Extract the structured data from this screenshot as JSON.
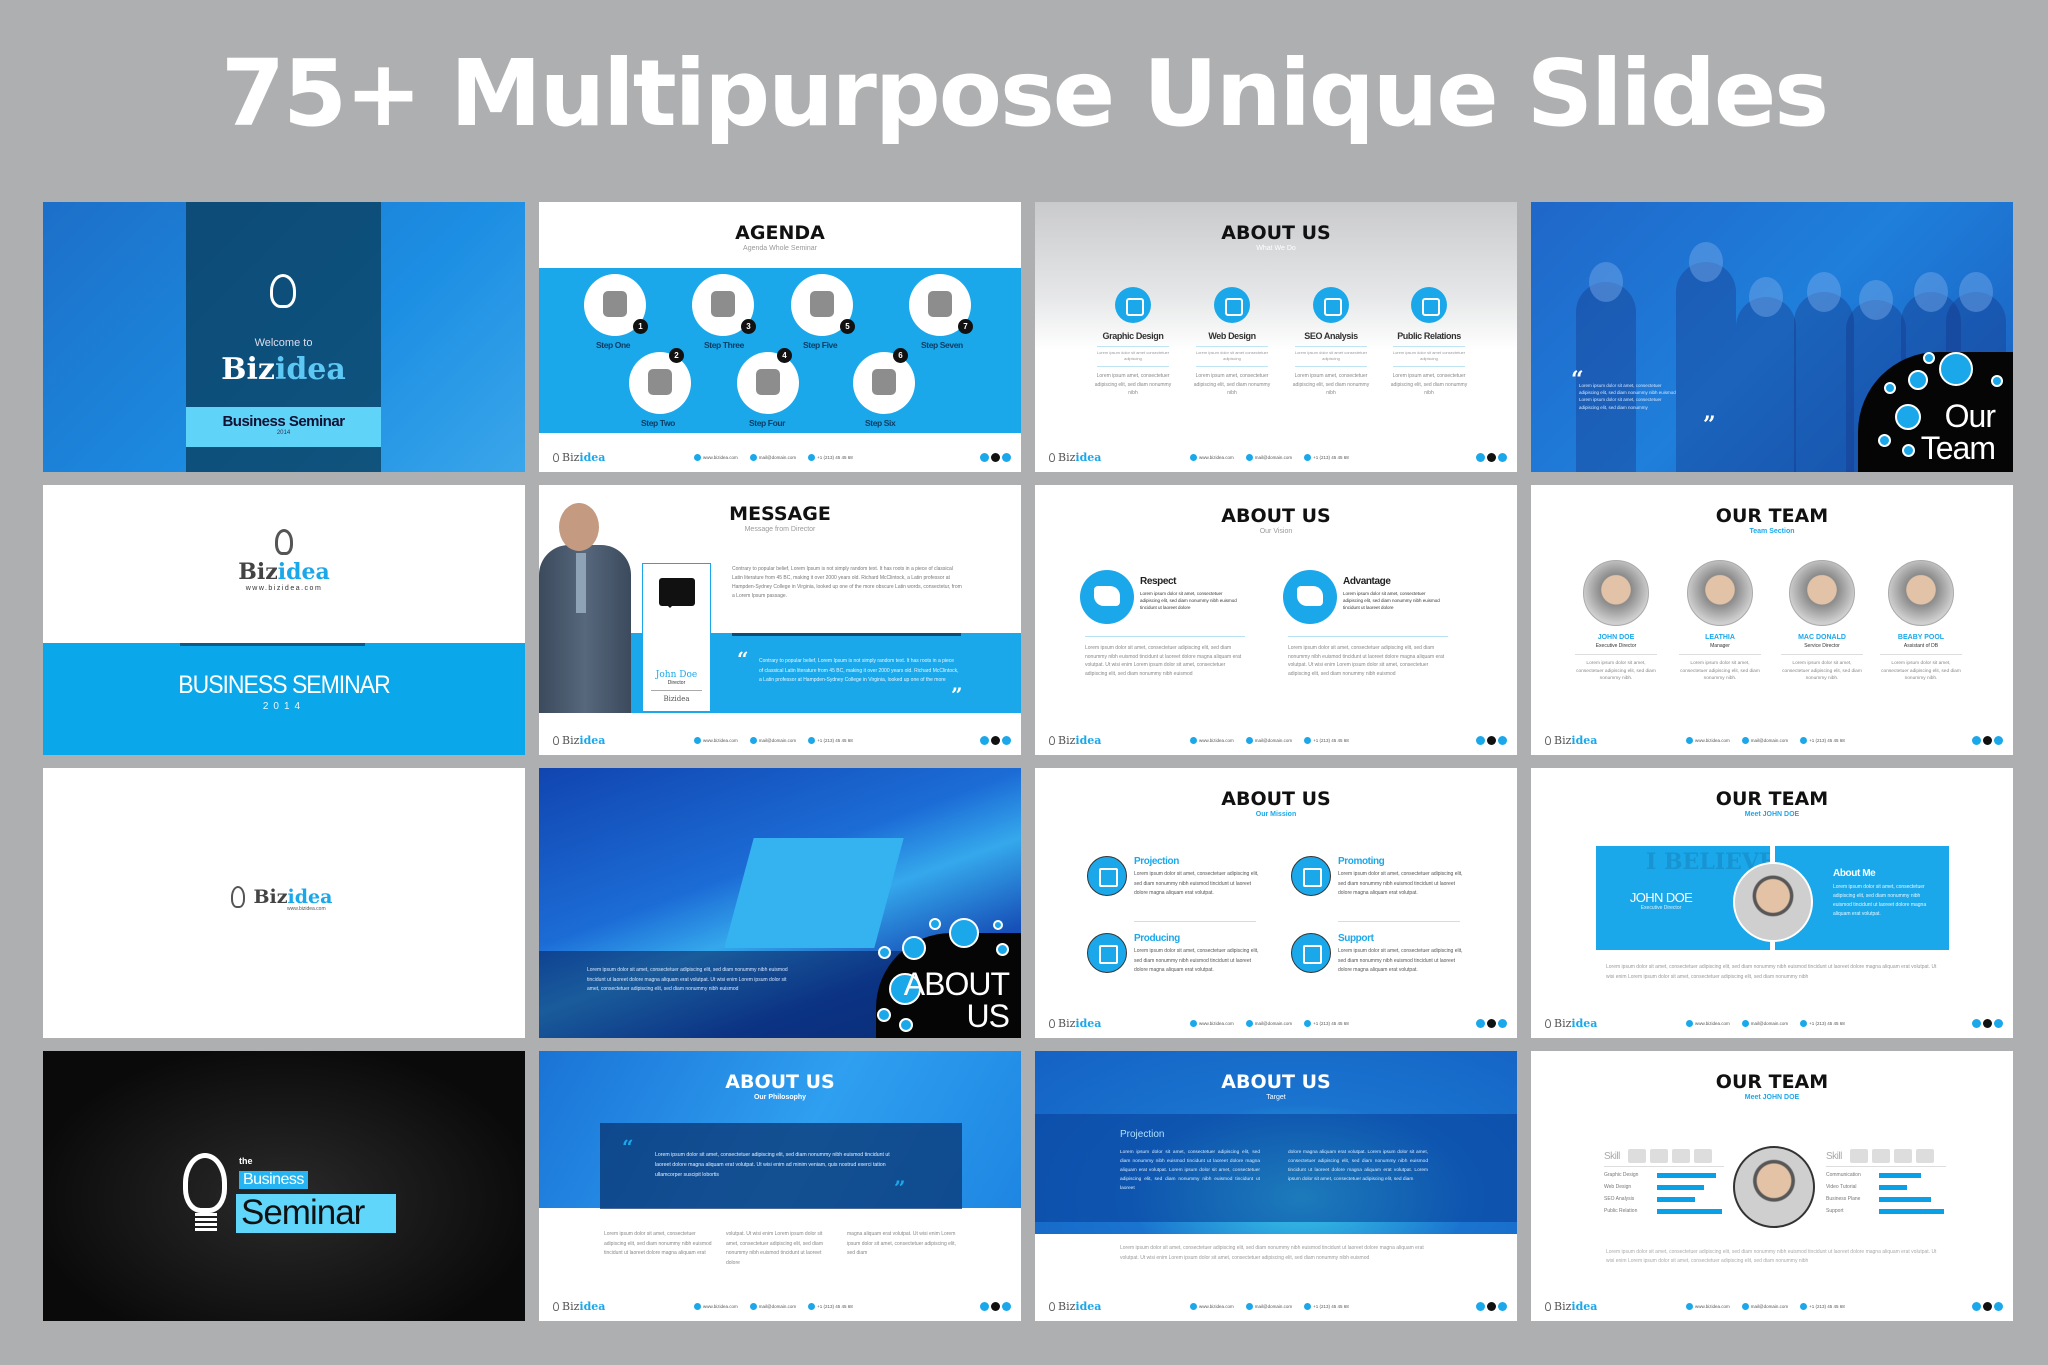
{
  "headline": "75+ Multipurpose Unique Slides",
  "colors": {
    "background": "#aeafb1",
    "accent": "#1ba8ea",
    "dark": "#050505"
  },
  "footer": {
    "logo_biz": "Biz",
    "logo_idea": "idea",
    "website": "www.bizidea.com",
    "email": "mail@domain.com",
    "phone": "+1 (213) 45 45 68",
    "social_icons": [
      "facebook-icon",
      "linkedin-icon",
      "twitter-icon"
    ]
  },
  "slides": {
    "welcome": {
      "welcome": "Welcome to",
      "biz": "Biz",
      "idea": "idea",
      "title": "Business Seminar",
      "year": "2014"
    },
    "agenda": {
      "title": "AGENDA",
      "subtitle": "Agenda Whole Seminar",
      "steps": [
        {
          "num": "1",
          "label": "Step One",
          "icon": "plug-icon"
        },
        {
          "num": "2",
          "label": "Step Two",
          "icon": "money-icon"
        },
        {
          "num": "3",
          "label": "Step Three",
          "icon": "lock-icon"
        },
        {
          "num": "4",
          "label": "Step Four",
          "icon": "document-coin-icon"
        },
        {
          "num": "5",
          "label": "Step Five",
          "icon": "briefcase-icon"
        },
        {
          "num": "6",
          "label": "Step Six",
          "icon": "basket-icon"
        },
        {
          "num": "7",
          "label": "Step Seven",
          "icon": "paperclip-icon"
        }
      ]
    },
    "about_what": {
      "title": "ABOUT US",
      "subtitle": "What We Do",
      "services": [
        {
          "name": "Graphic Design",
          "small": "Lorem ipsum dolor sit amet consectetuer adipiscing",
          "text": "Lorem ipsum amet, consectetuer adipiscing elit, sed diam nonummy nibh"
        },
        {
          "name": "Web Design",
          "small": "Lorem ipsum dolor sit amet consectetuer adipiscing",
          "text": "Lorem ipsum amet, consectetuer adipiscing elit, sed diam nonummy nibh"
        },
        {
          "name": "SEO Analysis",
          "small": "Lorem ipsum dolor sit amet consectetuer adipiscing",
          "text": "Lorem ipsum amet, consectetuer adipiscing elit, sed diam nonummy nibh"
        },
        {
          "name": "Public Relations",
          "small": "Lorem ipsum dolor sit amet consectetuer adipiscing",
          "text": "Lorem ipsum amet, consectetuer adipiscing elit, sed diam nonummy nibh"
        }
      ]
    },
    "team_photo": {
      "word1": "Our",
      "word2": "Team",
      "quote": "Lorem ipsum dolor sit amet, consectetuer adipiscing elit, sed diam nonummy nibh euismod Lorem ipsum dolor sit amet, consectetuer adipiscing elit, sed diam nonummy",
      "open_quote": "“",
      "close_quote": "”"
    },
    "business_seminar": {
      "biz": "Biz",
      "idea": "idea",
      "url": "www.bizidea.com",
      "title": "BUSINESS SEMINAR",
      "year": "2014"
    },
    "message": {
      "title": "MESSAGE",
      "subtitle": "Message from Director",
      "name": "John Doe",
      "role": "Director",
      "org": "Bizidea",
      "body": "Contrary to popular belief, Lorem Ipsum is not simply random text. It has roots in a piece of classical Latin literature from 45 BC, making it over 2000 years old. Richard McClintock, a Latin professor at Hampden-Sydney College in Virginia, looked up one of the more obscure Latin words, consectetur, from a Lorem Ipsum passage.",
      "quote": "Contrary to popular belief, Lorem Ipsum is not simply random text. It has roots in a piece of classical Latin literature from 45 BC, making it over 2000 years old. Richard McClintock, a Latin professor at Hampden-Sydney College in Virginia, looked up one of the more",
      "open_quote": "“",
      "close_quote": "”"
    },
    "about_vision": {
      "title": "ABOUT US",
      "subtitle": "Our Vision",
      "items": [
        {
          "heading": "Respect",
          "desc": "Lorem ipsum dolor sit amet, consectetuer adipiscing elit, sed diam nonummy nibh euismod tincidunt ut laoreet dolore",
          "text": "Lorem ipsum dolor sit amet, consectetuer adipiscing elit, sed diam nonummy nibh euismod tincidunt ut laoreet dolore magna aliquam erat volutpat. Ut wisi enim Lorem ipsum dolor sit amet, consectetuer adipiscing elit, sed diam nonummy nibh euismod",
          "icon": "handshake-icon"
        },
        {
          "heading": "Advantage",
          "desc": "Lorem ipsum dolor sit amet, consectetuer adipiscing elit, sed diam nonummy nibh euismod tincidunt ut laoreet dolore",
          "text": "Lorem ipsum dolor sit amet, consectetuer adipiscing elit, sed diam nonummy nibh euismod tincidunt ut laoreet dolore magna aliquam erat volutpat. Ut wisi enim Lorem ipsum dolor sit amet, consectetuer adipiscing elit, sed diam nonummy nibh euismod",
          "icon": "growth-chart-icon"
        }
      ]
    },
    "team_section": {
      "title": "OUR TEAM",
      "subtitle": "Team Section",
      "members": [
        {
          "name": "JOHN DOE",
          "role": "Executive Director",
          "text": "Lorem ipsum dolor sit amet, consectetuer adipiscing elit, sed diam nonummy nibh."
        },
        {
          "name": "LEATHIA",
          "role": "Manager",
          "text": "Lorem ipsum dolor sit amet, consectetuer adipiscing elit, sed diam nonummy nibh."
        },
        {
          "name": "MAC DONALD",
          "role": "Service Director",
          "text": "Lorem ipsum dolor sit amet, consectetuer adipiscing elit, sed diam nonummy nibh."
        },
        {
          "name": "BEABY POOL",
          "role": "Assistant of DB",
          "text": "Lorem ipsum dolor sit amet, consectetuer adipiscing elit, sed diam nonummy nibh."
        }
      ]
    },
    "logo_only": {
      "biz": "Biz",
      "idea": "idea",
      "url": "www.bizidea.com"
    },
    "about_city": {
      "word1": "ABOUT",
      "word2": "US",
      "text": "Lorem ipsum dolor sit amet, consectetuer adipiscing elit, sed diam nonummy nibh euismod tincidunt ut laoreet dolore magna aliquam erat volutpat. Ut wisi enim Lorem ipsum dolor sit amet, consectetuer adipiscing elit, sed diam nonummy nibh euismod"
    },
    "about_mission": {
      "title": "ABOUT US",
      "subtitle": "Our Mission",
      "items": [
        {
          "heading": "Projection",
          "text": "Lorem ipsum dolor sit amet, consectetuer adipiscing elit, sed diam nonummy nibh euismod tincidunt ut laoreet dolore magna aliquam erat volutpat.",
          "icon": "presentation-board-icon"
        },
        {
          "heading": "Promoting",
          "text": "Lorem ipsum dolor sit amet, consectetuer adipiscing elit, sed diam nonummy nibh euismod tincidunt ut laoreet dolore magna aliquam erat volutpat.",
          "icon": "rocket-icon"
        },
        {
          "heading": "Producing",
          "text": "Lorem ipsum dolor sit amet, consectetuer adipiscing elit, sed diam nonummy nibh euismod tincidunt ut laoreet dolore magna aliquam erat volutpat.",
          "icon": "gears-icon"
        },
        {
          "heading": "Support",
          "text": "Lorem ipsum dolor sit amet, consectetuer adipiscing elit, sed diam nonummy nibh euismod tincidunt ut laoreet dolore magna aliquam erat volutpat.",
          "icon": "chat-bubbles-icon"
        }
      ]
    },
    "meet_john": {
      "title": "OUR TEAM",
      "subtitle": "Meet JOHN DOE",
      "name": "JOHN DOE",
      "role": "Executive Director",
      "ghost_text": "I BELIEVE IN DESIGN GOOD DESIGN THAT IS DESIGN THAT S",
      "about_heading": "About Me",
      "about_text": "Lorem ipsum dolor sit amet, consectetuer adipiscing elit, sed diam nonummy nibh euismod tincidunt ut laoreet dolore magna aliquam erat volutpat.",
      "footer_text": "Lorem ipsum dolor sit amet, consectetuer adipiscing elit, sed diam nonummy nibh euismod tincidunt ut laoreet dolore magna aliquam erat volutpat. Ut wisi enim Lorem ipsum dolor sit amet, consectetuer adipiscing elit, sed diam nonummy nibh"
    },
    "dark_seminar": {
      "the": "the",
      "word1": "Business",
      "word2": "Seminar"
    },
    "about_philosophy": {
      "title": "ABOUT US",
      "subtitle": "Our Philosophy",
      "quote": "Lorem ipsum dolor sit amet, consectetuer adipiscing elit, sed diam nonummy nibh euismod tincidunt ut laoreet dolore magna aliquam erat volutpat. Ut wisi enim ad minim veniam, quis nostrud exerci tation ullamcorper suscipit lobortis",
      "open_quote": "“",
      "close_quote": "”",
      "columns": [
        "Lorem ipsum dolor sit amet, consectetuer adipiscing elit, sed diam nonummy nibh euismod tincidunt ut laoreet dolore magna aliquam erat",
        "volutpat. Ut wisi enim Lorem ipsum dolor sit amet, consectetuer adipiscing elit, sed diam nonummy nibh euismod tincidunt ut laoreet dolore",
        "magna aliquam erat volutpat. Ut wisi enim Lorem ipsum dolor sit amet, consectetuer adipiscing elit, sed diam"
      ]
    },
    "about_target": {
      "title": "ABOUT US",
      "subtitle": "Target",
      "heading": "Projection",
      "col1": "Lorem ipsum dolor sit amet, consectetuer adipiscing elit, sed diam nonummy nibh euismod tincidunt ut laoreet dolore magna aliquam erat volutpat. Lorem ipsum dolor sit amet, consectetuer adipiscing elit, sed diam nonummy nibh euismod tincidunt ut laoreet",
      "col2": "dolore magna aliquam erat volutpat. Lorem ipsum dolor sit amet, consectetuer adipiscing elit, sed diam nonummy nibh euismod tincidunt ut laoreet dolore magna aliquam erat volutpat. Lorem ipsum dolor sit amet, consectetuer adipiscing elit, sed diam",
      "bottom": "Lorem ipsum dolor sit amet, consectetuer adipiscing elit, sed diam nonummy nibh euismod tincidunt ut laoreet dolore magna aliquam erat volutpat. Ut wisi enim Lorem ipsum dolor sit amet, consectetuer adipiscing elit, sed diam nonummy nibh euismod"
    },
    "skills": {
      "title": "OUR TEAM",
      "subtitle": "Meet JOHN DOE",
      "skill_label": "Skill",
      "left": [
        {
          "label": "Graphic Design",
          "value": 0.9
        },
        {
          "label": "Web Design",
          "value": 0.72
        },
        {
          "label": "SEO Analysis",
          "value": 0.58
        },
        {
          "label": "Public Relation",
          "value": 1.0
        }
      ],
      "right": [
        {
          "label": "Communication",
          "value": 0.64
        },
        {
          "label": "Video Tutorial",
          "value": 0.43
        },
        {
          "label": "Business Plane",
          "value": 0.8
        },
        {
          "label": "Support",
          "value": 1.0
        }
      ],
      "footer_text": "Lorem ipsum dolor sit amet, consectetuer adipiscing elit, sed diam nonummy nibh euismod tincidunt ut laoreet dolore magna aliquam erat volutpat. Ut wisi enim Lorem ipsum dolor sit amet, consectetuer adipiscing elit, sed diam nonummy nibh"
    }
  }
}
